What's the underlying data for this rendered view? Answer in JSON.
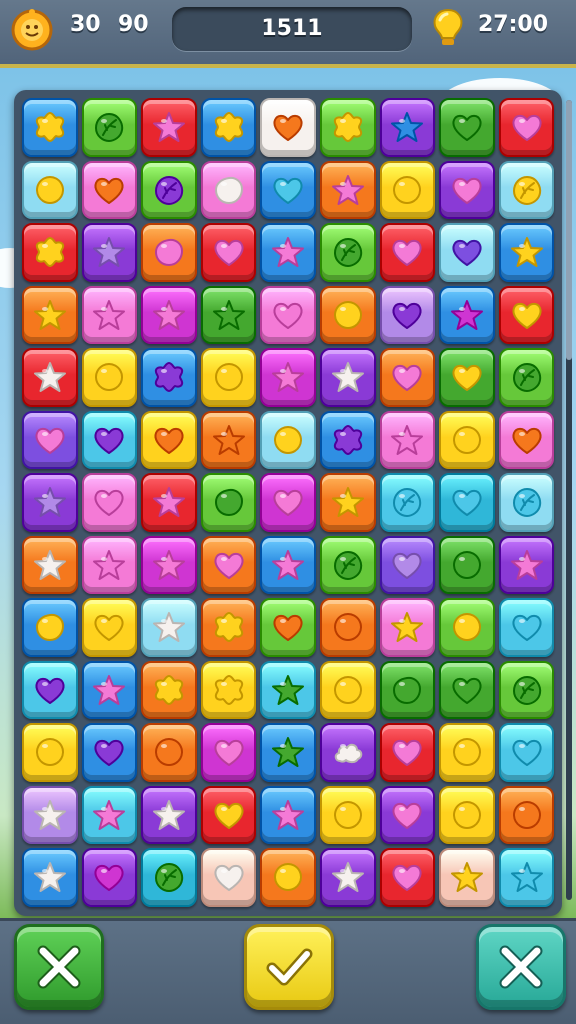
{
  "hud": {
    "left_value_1": "30",
    "left_value_2": "90",
    "score": "1511",
    "timer": "27:00",
    "face_icon": "smiley-face-icon",
    "bulb_icon": "lightbulb-icon"
  },
  "palette": {
    "blue": "#2f8fe3",
    "lime": "#66c83a",
    "red": "#e8262e",
    "white": "#f6f1ee",
    "purple": "#8a3ad6",
    "green": "#44a82f",
    "sky": "#8fdcf2",
    "pink": "#f47ad6",
    "orange": "#f5781d",
    "yellow": "#ffd21e",
    "magenta": "#cf35d2",
    "cyan": "#4cc7e8",
    "lavender": "#b28ae8",
    "peach": "#f7c6b6",
    "teal": "#2fb7d8",
    "violet": "#7d4fe0"
  },
  "board": {
    "columns": 9,
    "rows": [
      [
        [
          "blue",
          "flower",
          "yellow"
        ],
        [
          "lime",
          "leaf",
          "green"
        ],
        [
          "red",
          "star",
          "pink"
        ],
        [
          "blue",
          "flower",
          "yellow"
        ],
        [
          "white",
          "heart",
          "orange"
        ],
        [
          "lime",
          "flower",
          "yellow"
        ],
        [
          "purple",
          "star",
          "blue"
        ],
        [
          "green",
          "heart",
          "green"
        ],
        [
          "red",
          "heart",
          "pink"
        ]
      ],
      [
        [
          "sky",
          "circle",
          "yellow"
        ],
        [
          "pink",
          "heart",
          "orange"
        ],
        [
          "lime",
          "leaf",
          "purple"
        ],
        [
          "pink",
          "blob",
          "white"
        ],
        [
          "blue",
          "heart",
          "cyan"
        ],
        [
          "orange",
          "star",
          "pink"
        ],
        [
          "yellow",
          "circle",
          "yellow"
        ],
        [
          "purple",
          "heart",
          "pink"
        ],
        [
          "sky",
          "leaf",
          "yellow"
        ]
      ],
      [
        [
          "red",
          "flower",
          "yellow"
        ],
        [
          "purple",
          "star",
          "lavender"
        ],
        [
          "orange",
          "blob",
          "pink"
        ],
        [
          "red",
          "heart",
          "pink"
        ],
        [
          "blue",
          "star",
          "pink"
        ],
        [
          "lime",
          "leaf",
          "green"
        ],
        [
          "red",
          "heart",
          "pink"
        ],
        [
          "sky",
          "heart",
          "violet"
        ],
        [
          "blue",
          "star",
          "yellow"
        ]
      ],
      [
        [
          "orange",
          "star",
          "yellow"
        ],
        [
          "pink",
          "star",
          "pink"
        ],
        [
          "magenta",
          "star",
          "pink"
        ],
        [
          "green",
          "star",
          "green"
        ],
        [
          "pink",
          "heart",
          "pink"
        ],
        [
          "orange",
          "circle",
          "yellow"
        ],
        [
          "lavender",
          "heart",
          "purple"
        ],
        [
          "blue",
          "star",
          "magenta"
        ],
        [
          "red",
          "heart",
          "yellow"
        ]
      ],
      [
        [
          "red",
          "star",
          "white"
        ],
        [
          "yellow",
          "circle",
          "yellow"
        ],
        [
          "blue",
          "flower",
          "purple"
        ],
        [
          "yellow",
          "circle",
          "yellow"
        ],
        [
          "magenta",
          "star",
          "pink"
        ],
        [
          "purple",
          "star",
          "white"
        ],
        [
          "orange",
          "heart",
          "pink"
        ],
        [
          "green",
          "heart",
          "yellow"
        ],
        [
          "lime",
          "leaf",
          "green"
        ]
      ],
      [
        [
          "violet",
          "heart",
          "pink"
        ],
        [
          "cyan",
          "heart",
          "purple"
        ],
        [
          "yellow",
          "heart",
          "orange"
        ],
        [
          "orange",
          "star",
          "orange"
        ],
        [
          "sky",
          "circle",
          "yellow"
        ],
        [
          "blue",
          "flower",
          "purple"
        ],
        [
          "pink",
          "star",
          "pink"
        ],
        [
          "yellow",
          "circle",
          "yellow"
        ],
        [
          "pink",
          "heart",
          "orange"
        ]
      ],
      [
        [
          "purple",
          "star",
          "lavender"
        ],
        [
          "pink",
          "heart",
          "pink"
        ],
        [
          "red",
          "star",
          "pink"
        ],
        [
          "lime",
          "blob",
          "green"
        ],
        [
          "magenta",
          "heart",
          "pink"
        ],
        [
          "orange",
          "star",
          "yellow"
        ],
        [
          "cyan",
          "leaf",
          "cyan"
        ],
        [
          "teal",
          "heart",
          "cyan"
        ],
        [
          "sky",
          "leaf",
          "cyan"
        ]
      ],
      [
        [
          "orange",
          "star",
          "white"
        ],
        [
          "pink",
          "star",
          "pink"
        ],
        [
          "magenta",
          "star",
          "pink"
        ],
        [
          "orange",
          "heart",
          "pink"
        ],
        [
          "blue",
          "star",
          "pink"
        ],
        [
          "lime",
          "leaf",
          "green"
        ],
        [
          "violet",
          "heart",
          "lavender"
        ],
        [
          "green",
          "circle",
          "green"
        ],
        [
          "purple",
          "star",
          "pink"
        ]
      ],
      [
        [
          "blue",
          "blob",
          "yellow"
        ],
        [
          "yellow",
          "heart",
          "yellow"
        ],
        [
          "sky",
          "star",
          "white"
        ],
        [
          "orange",
          "flower",
          "yellow"
        ],
        [
          "lime",
          "heart",
          "orange"
        ],
        [
          "orange",
          "circle",
          "orange"
        ],
        [
          "pink",
          "star",
          "yellow"
        ],
        [
          "lime",
          "circle",
          "yellow"
        ],
        [
          "cyan",
          "heart",
          "cyan"
        ]
      ],
      [
        [
          "cyan",
          "heart",
          "purple"
        ],
        [
          "blue",
          "star",
          "pink"
        ],
        [
          "orange",
          "flower",
          "yellow"
        ],
        [
          "yellow",
          "flower",
          "yellow"
        ],
        [
          "cyan",
          "star",
          "green"
        ],
        [
          "yellow",
          "circle",
          "yellow"
        ],
        [
          "green",
          "blob",
          "green"
        ],
        [
          "green",
          "heart",
          "green"
        ],
        [
          "lime",
          "leaf",
          "green"
        ]
      ],
      [
        [
          "yellow",
          "circle",
          "yellow"
        ],
        [
          "blue",
          "heart",
          "purple"
        ],
        [
          "orange",
          "circle",
          "orange"
        ],
        [
          "magenta",
          "heart",
          "pink"
        ],
        [
          "blue",
          "star",
          "green"
        ],
        [
          "purple",
          "cloud",
          "white"
        ],
        [
          "red",
          "heart",
          "pink"
        ],
        [
          "yellow",
          "circle",
          "yellow"
        ],
        [
          "cyan",
          "heart",
          "cyan"
        ]
      ],
      [
        [
          "lavender",
          "star",
          "white"
        ],
        [
          "cyan",
          "star",
          "pink"
        ],
        [
          "purple",
          "star",
          "white"
        ],
        [
          "red",
          "heart",
          "yellow"
        ],
        [
          "blue",
          "star",
          "pink"
        ],
        [
          "yellow",
          "circle",
          "yellow"
        ],
        [
          "purple",
          "heart",
          "pink"
        ],
        [
          "yellow",
          "circle",
          "yellow"
        ],
        [
          "orange",
          "circle",
          "orange"
        ]
      ],
      [
        [
          "blue",
          "star",
          "white"
        ],
        [
          "purple",
          "heart",
          "magenta"
        ],
        [
          "teal",
          "leaf",
          "green"
        ],
        [
          "peach",
          "heart",
          "white"
        ],
        [
          "orange",
          "circle",
          "yellow"
        ],
        [
          "purple",
          "star",
          "white"
        ],
        [
          "red",
          "heart",
          "pink"
        ],
        [
          "peach",
          "star",
          "yellow"
        ],
        [
          "cyan",
          "star",
          "cyan"
        ]
      ]
    ]
  },
  "buttons": {
    "left_icon": "close-x-icon",
    "middle_icon": "checkmark-icon",
    "right_icon": "close-x-icon"
  }
}
